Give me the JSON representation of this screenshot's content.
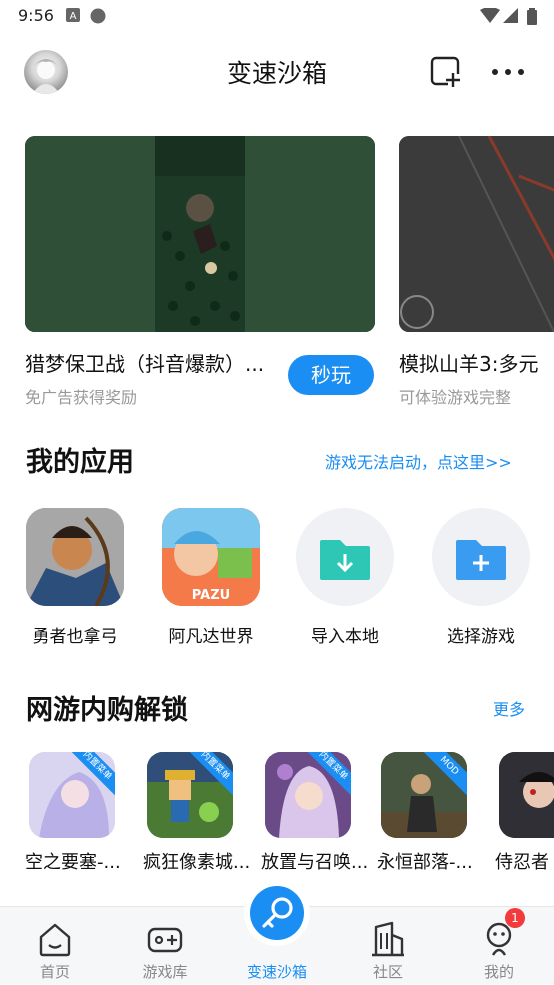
{
  "status_bar": {
    "time": "9:56"
  },
  "header": {
    "title": "变速沙箱"
  },
  "featured": [
    {
      "title": "猎梦保卫战（抖音爆款）...",
      "subtitle": "免广告获得奖励",
      "action": "秒玩"
    },
    {
      "title": "模拟山羊3:多元",
      "subtitle": "可体验游戏完整"
    }
  ],
  "my_apps": {
    "title": "我的应用",
    "help_link": "游戏无法启动，点这里>>",
    "items": [
      {
        "label": "勇者也拿弓"
      },
      {
        "label": "阿凡达世界"
      },
      {
        "label": "导入本地"
      },
      {
        "label": "选择游戏"
      }
    ]
  },
  "unlock": {
    "title": "网游内购解锁",
    "more": "更多",
    "items": [
      {
        "label": "空之要塞-...",
        "tag": "内置菜单"
      },
      {
        "label": "疯狂像素城...",
        "tag": "内置菜单"
      },
      {
        "label": "放置与召唤...",
        "tag": "内置菜单"
      },
      {
        "label": "永恒部落-...",
        "tag": "MOD"
      },
      {
        "label": "侍忍者"
      }
    ]
  },
  "bottom_nav": {
    "items": [
      {
        "label": "首页"
      },
      {
        "label": "游戏库"
      },
      {
        "label": "变速沙箱"
      },
      {
        "label": "社区"
      },
      {
        "label": "我的"
      }
    ],
    "badge": "1"
  },
  "colors": {
    "accent": "#1a8ef2",
    "badge": "#f23b3b"
  }
}
